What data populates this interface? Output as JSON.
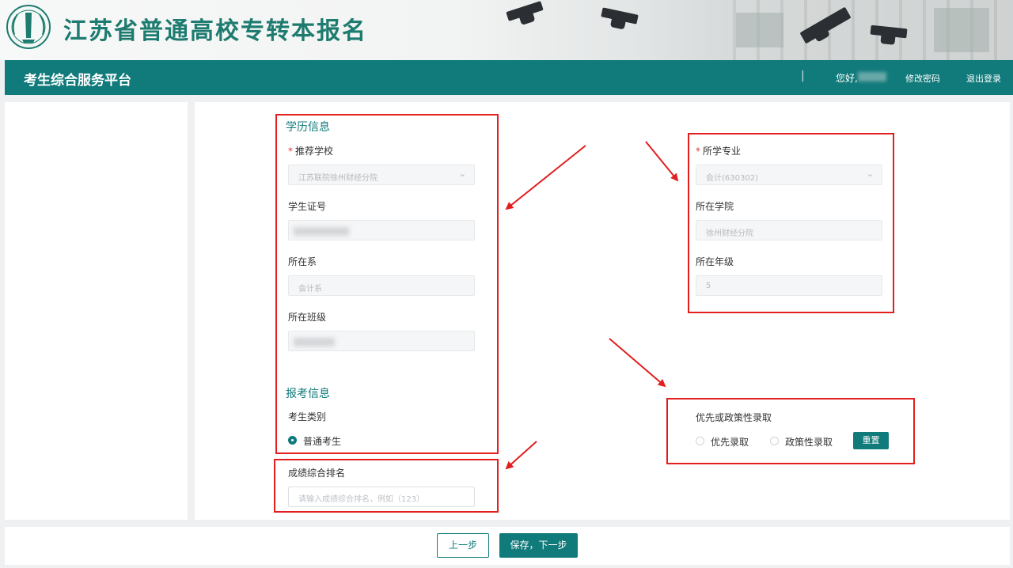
{
  "header": {
    "site_title": "江苏省普通高校专转本报名",
    "logo_icon": "school-emblem-icon"
  },
  "navbar": {
    "platform_name": "考生综合服务平台",
    "separator": "|",
    "greeting": "您好,",
    "change_password": "修改密码",
    "logout": "退出登录",
    "color": "#117a7b"
  },
  "education_info": {
    "title": "学历信息",
    "recommended_school": {
      "label": "推荐学校",
      "required_mark": "*",
      "value": "江苏联院徐州财经分院"
    },
    "student_id": {
      "label": "学生证号"
    },
    "department": {
      "label": "所在系",
      "value": "会计系"
    },
    "class_name": {
      "label": "所在班级"
    },
    "major": {
      "label": "所学专业",
      "required_mark": "*",
      "value": "会计(630302)"
    },
    "college": {
      "label": "所在学院",
      "value": "徐州财经分院"
    },
    "grade": {
      "label": "所在年级",
      "value": "5"
    }
  },
  "exam_info": {
    "title": "报考信息",
    "candidate_type_label": "考生类别",
    "candidate_type_value": "普通考生",
    "ranking_label": "成绩综合排名",
    "ranking_placeholder": "请输入成绩综合排名，例如（123）"
  },
  "priority": {
    "label": "优先或政策性录取",
    "option_priority": "优先录取",
    "option_policy": "政策性录取",
    "reset_button": "重置"
  },
  "footer": {
    "prev_button": "上一步",
    "next_button": "保存，下一步"
  },
  "annotations": {
    "highlight_color": "#e21e1e"
  }
}
